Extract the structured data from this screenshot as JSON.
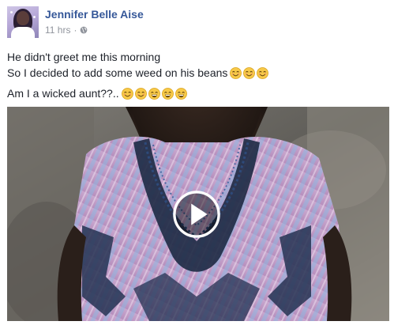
{
  "post": {
    "author": "Jennifer Belle Aise",
    "time": "11 hrs",
    "separator": "·",
    "privacy_icon": "globe-icon",
    "lines": [
      "He didn't greet me this morning",
      "So I decided to add some weed on his beans",
      "Am I a wicked aunt??.."
    ],
    "line2_emoji": [
      "smiling-face-icon",
      "smiling-face-icon",
      "smiling-face-icon"
    ],
    "line3_emoji": [
      "smiling-face-icon",
      "smiling-face-icon",
      "grinning-face-icon",
      "grinning-face-icon",
      "grinning-face-icon"
    ]
  },
  "video": {
    "play_icon": "play-icon"
  },
  "colors": {
    "author": "#365899",
    "meta": "#90949c",
    "text": "#1d2129",
    "emoji": "#f7c948"
  }
}
